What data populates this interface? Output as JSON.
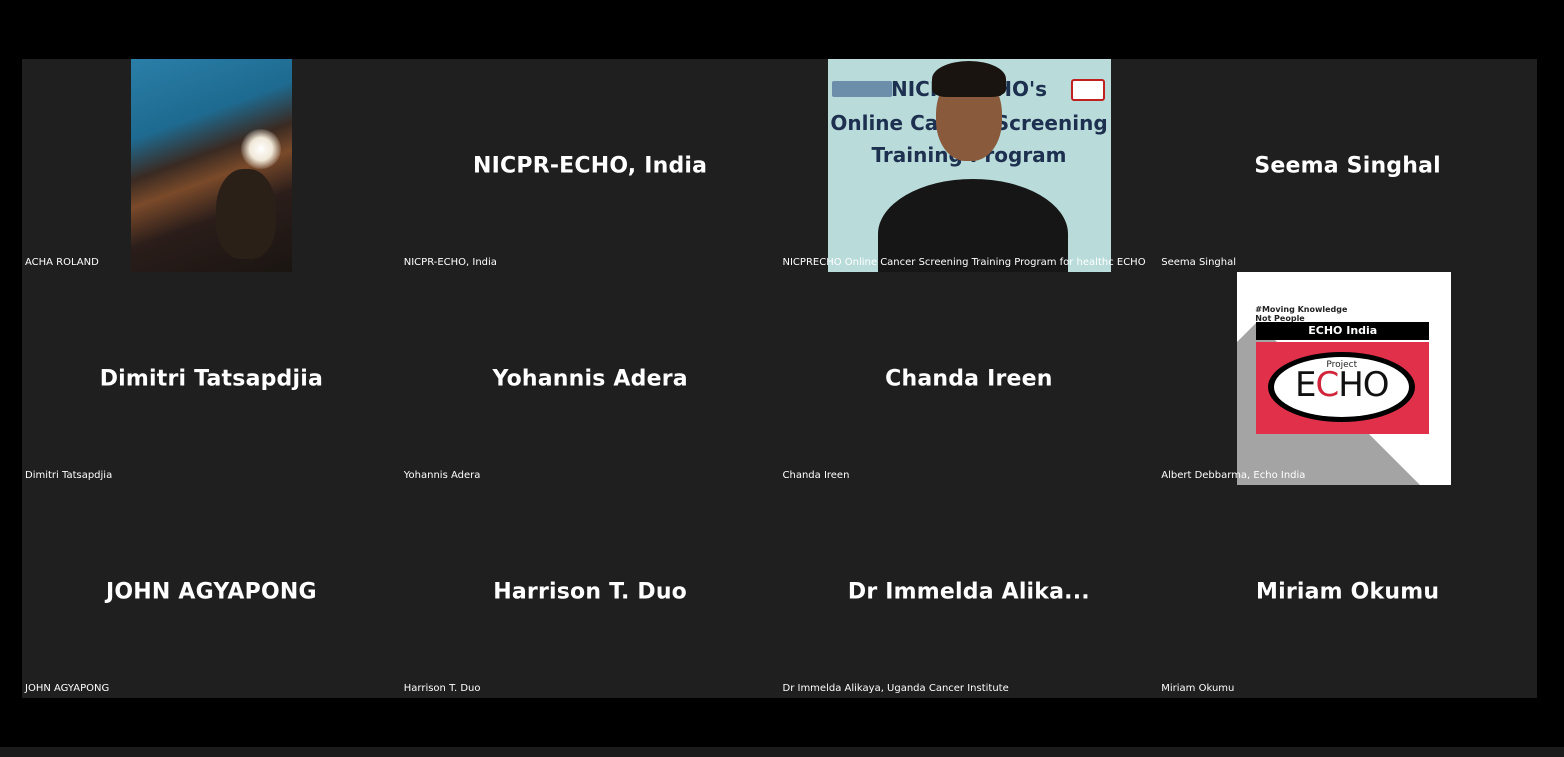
{
  "participants": [
    {
      "small_label": "ACHA ROLAND",
      "big_label": "",
      "kind": "video"
    },
    {
      "small_label": "NICPR-ECHO, India",
      "big_label": "NICPR-ECHO, India",
      "kind": "name"
    },
    {
      "small_label": "NICPRECHO Online Cancer Screening Training Program for healthc ECHO",
      "big_label": "",
      "kind": "video"
    },
    {
      "small_label": "Seema Singhal",
      "big_label": "Seema Singhal",
      "kind": "name"
    },
    {
      "small_label": "Dimitri Tatsapdjia",
      "big_label": "Dimitri Tatsapdjia",
      "kind": "name"
    },
    {
      "small_label": "Yohannis Adera",
      "big_label": "Yohannis Adera",
      "kind": "name"
    },
    {
      "small_label": "Chanda Ireen",
      "big_label": "Chanda Ireen",
      "kind": "name"
    },
    {
      "small_label": "Albert Debbarma, Echo India",
      "big_label": "",
      "kind": "image"
    },
    {
      "small_label": "JOHN AGYAPONG",
      "big_label": "JOHN AGYAPONG",
      "kind": "name"
    },
    {
      "small_label": "Harrison T. Duo",
      "big_label": "Harrison T. Duo",
      "kind": "name"
    },
    {
      "small_label": "Dr Immelda Alikaya, Uganda Cancer Institute",
      "big_label": "Dr Immelda Alika...",
      "kind": "name"
    },
    {
      "small_label": "Miriam Okumu",
      "big_label": "Miriam Okumu",
      "kind": "name"
    }
  ],
  "presenter_video": {
    "line1": "NICPR  ECHO's",
    "line2": "Online Cancer Screening",
    "line3": "Training Program"
  },
  "echo_card": {
    "hashtag": "#Moving Knowledge",
    "hashtag2": "Not People",
    "header": "ECHO India",
    "project": "Project",
    "echo_e": "E",
    "echo_c": "C",
    "echo_ho": "HO"
  },
  "colors": {
    "tile_bg": "#1f1f1f",
    "frame_bg": "#000000",
    "text": "#ffffff",
    "echo_red": "#e0304a"
  }
}
